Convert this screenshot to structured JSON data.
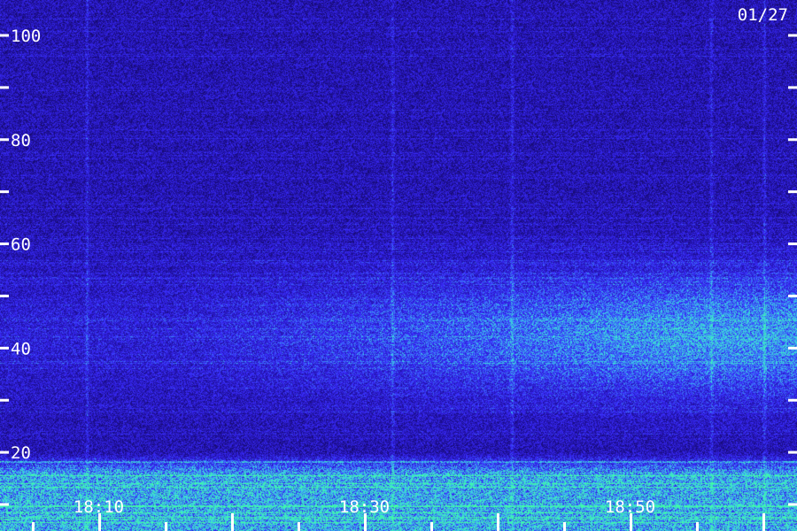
{
  "date_label": "01/27",
  "chart_data": {
    "type": "heatmap",
    "title": "",
    "xlabel": "",
    "ylabel": "",
    "y_axis": {
      "range": [
        0,
        100
      ],
      "labeled_ticks": [
        20,
        40,
        60,
        80,
        100
      ],
      "minor_ticks": [
        10,
        30,
        50,
        70,
        90
      ],
      "tick_labels": [
        "20",
        "40",
        "60",
        "80",
        "100"
      ]
    },
    "x_axis": {
      "range": [
        "18:02:30",
        "18:62:30"
      ],
      "labeled_ticks": [
        "18:10",
        "18:30",
        "18:50"
      ],
      "tick_labels": [
        "18:10",
        "18:30",
        "18:50"
      ],
      "minor_tick_interval_min": 5
    },
    "colormap": [
      "#0a0530",
      "#2010a0",
      "#3a2cff",
      "#3cd0e8",
      "#40ffa0"
    ],
    "intensity_regions": [
      {
        "name": "low-band noise",
        "y_range": [
          0,
          20
        ],
        "x_range": [
          "18:02",
          "19:02"
        ],
        "level": 0.8
      },
      {
        "name": "diffuse emission",
        "y_range": [
          30,
          55
        ],
        "x_range": [
          "18:15",
          "19:00"
        ],
        "level": 0.45,
        "peak_y": 43,
        "peak_x": "18:53"
      }
    ],
    "vertical_streaks_x": [
      "18:09",
      "18:32",
      "18:41",
      "18:56",
      "19:00"
    ]
  }
}
